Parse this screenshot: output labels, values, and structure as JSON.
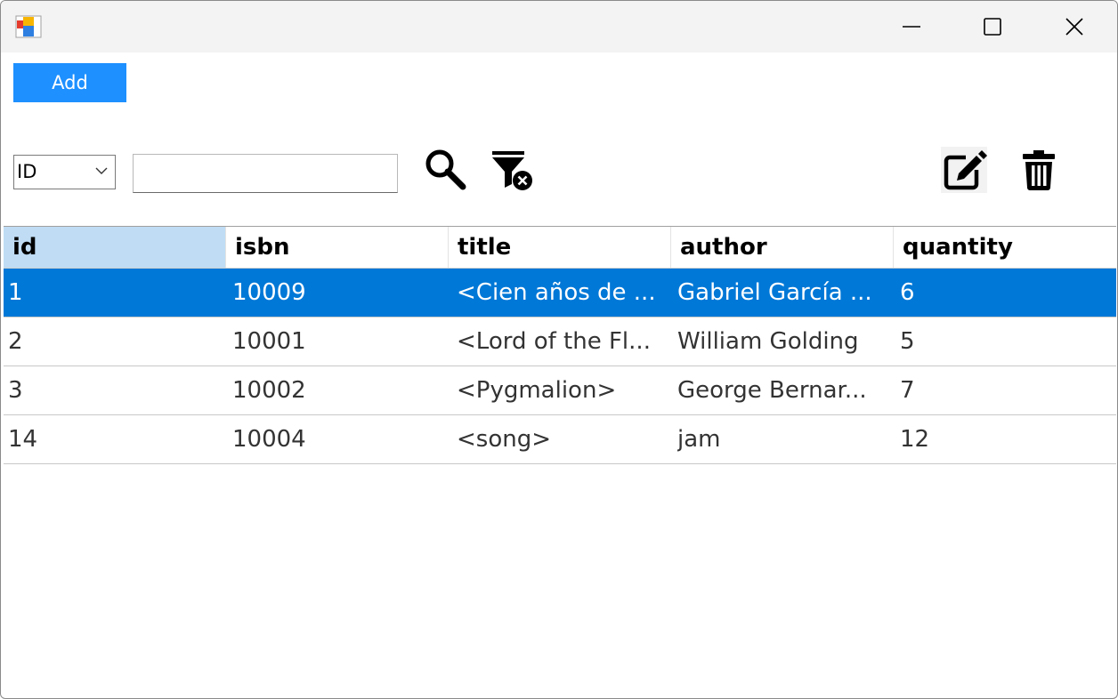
{
  "window": {
    "controls": {
      "minimize": "minimize",
      "maximize": "maximize",
      "close": "close"
    }
  },
  "toolbar": {
    "add_label": "Add",
    "filter_field": "ID",
    "search_value": "",
    "icons": [
      "search-icon",
      "clear-filter-icon",
      "edit-icon",
      "delete-icon"
    ]
  },
  "table": {
    "columns": [
      "id",
      "isbn",
      "title",
      "author",
      "quantity"
    ],
    "rows": [
      {
        "id": "1",
        "isbn": "10009",
        "title": "<Cien años de ...",
        "author": "Gabriel García ...",
        "quantity": "6",
        "selected": true
      },
      {
        "id": "2",
        "isbn": "10001",
        "title": "<Lord of the Fl...",
        "author": "William Golding",
        "quantity": "5"
      },
      {
        "id": "3",
        "isbn": "10002",
        "title": "<Pygmalion>",
        "author": "George Bernar...",
        "quantity": "7"
      },
      {
        "id": "14",
        "isbn": "10004",
        "title": "<song>",
        "author": "jam",
        "quantity": "12"
      }
    ]
  },
  "colors": {
    "accent": "#1e90ff",
    "selection": "#0078d7",
    "header_active": "#bfdcf4"
  }
}
